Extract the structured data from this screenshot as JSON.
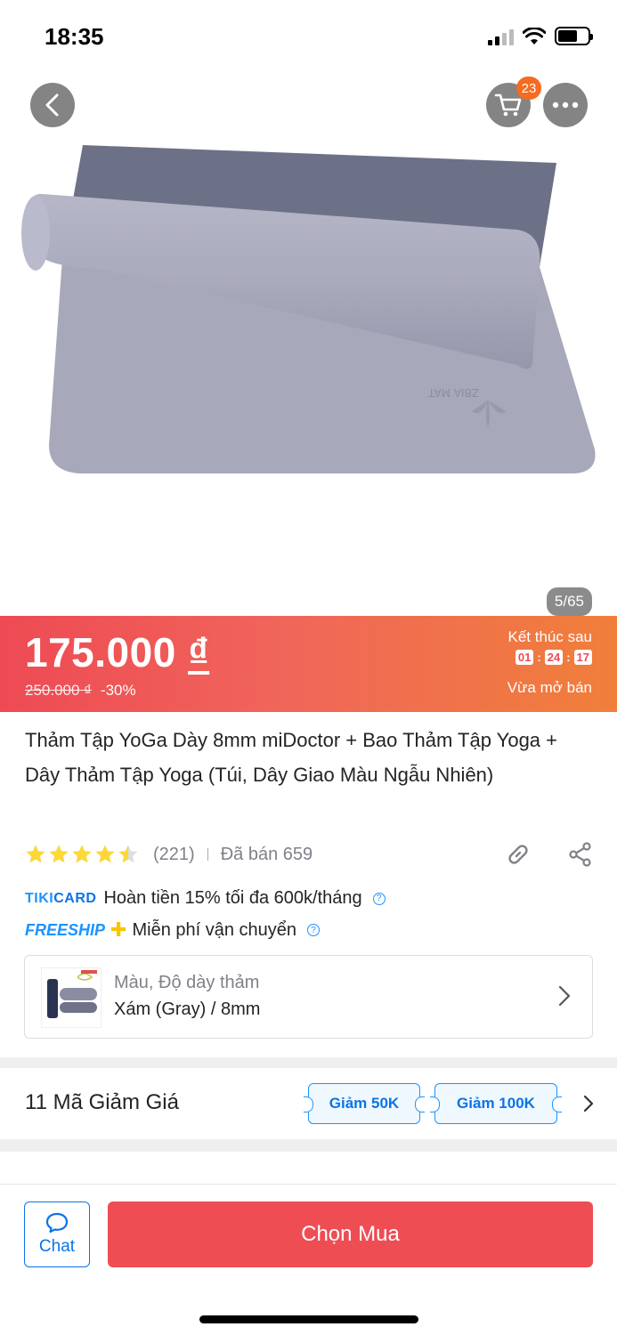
{
  "status_bar": {
    "time": "18:35"
  },
  "header": {
    "cart_count": "23"
  },
  "gallery": {
    "counter": "5/65",
    "mat_brand": "ZBIA MAT"
  },
  "price": {
    "current": "175.000",
    "currency": "₫",
    "original": "250.000 ₫",
    "discount": "-30%"
  },
  "deal": {
    "title": "Kết thúc sau",
    "hours": "01",
    "minutes": "24",
    "seconds": "17",
    "subtitle": "Vừa mở bán"
  },
  "product": {
    "title": "Thảm Tập YoGa Dày 8mm miDoctor + Bao Thảm Tập Yoga + Dây Thảm Tập Yoga (Túi, Dây Giao Màu Ngẫu Nhiên)",
    "rating_value": 4.5,
    "rating_count": "(221)",
    "sold": "Đã bán 659"
  },
  "promos": {
    "tikicard_logo_a": "TIKI",
    "tikicard_logo_b": "CARD",
    "tikicard_text": "Hoàn tiền 15% tối đa 600k/tháng",
    "freeship_logo": "FREESHIP",
    "freeship_text": "Miễn phí vận chuyển"
  },
  "variant": {
    "label": "Màu, Độ dày thảm",
    "value": "Xám (Gray) / 8mm"
  },
  "coupons": {
    "title": "11 Mã Giảm Giá",
    "items": [
      "Giảm 50K",
      "Giảm 100K"
    ]
  },
  "actions": {
    "chat_label": "Chat",
    "buy_label": "Chọn Mua"
  },
  "colors": {
    "accent_red": "#ee4d54",
    "tiki_blue": "#1a94ff",
    "star": "#fdd836"
  }
}
